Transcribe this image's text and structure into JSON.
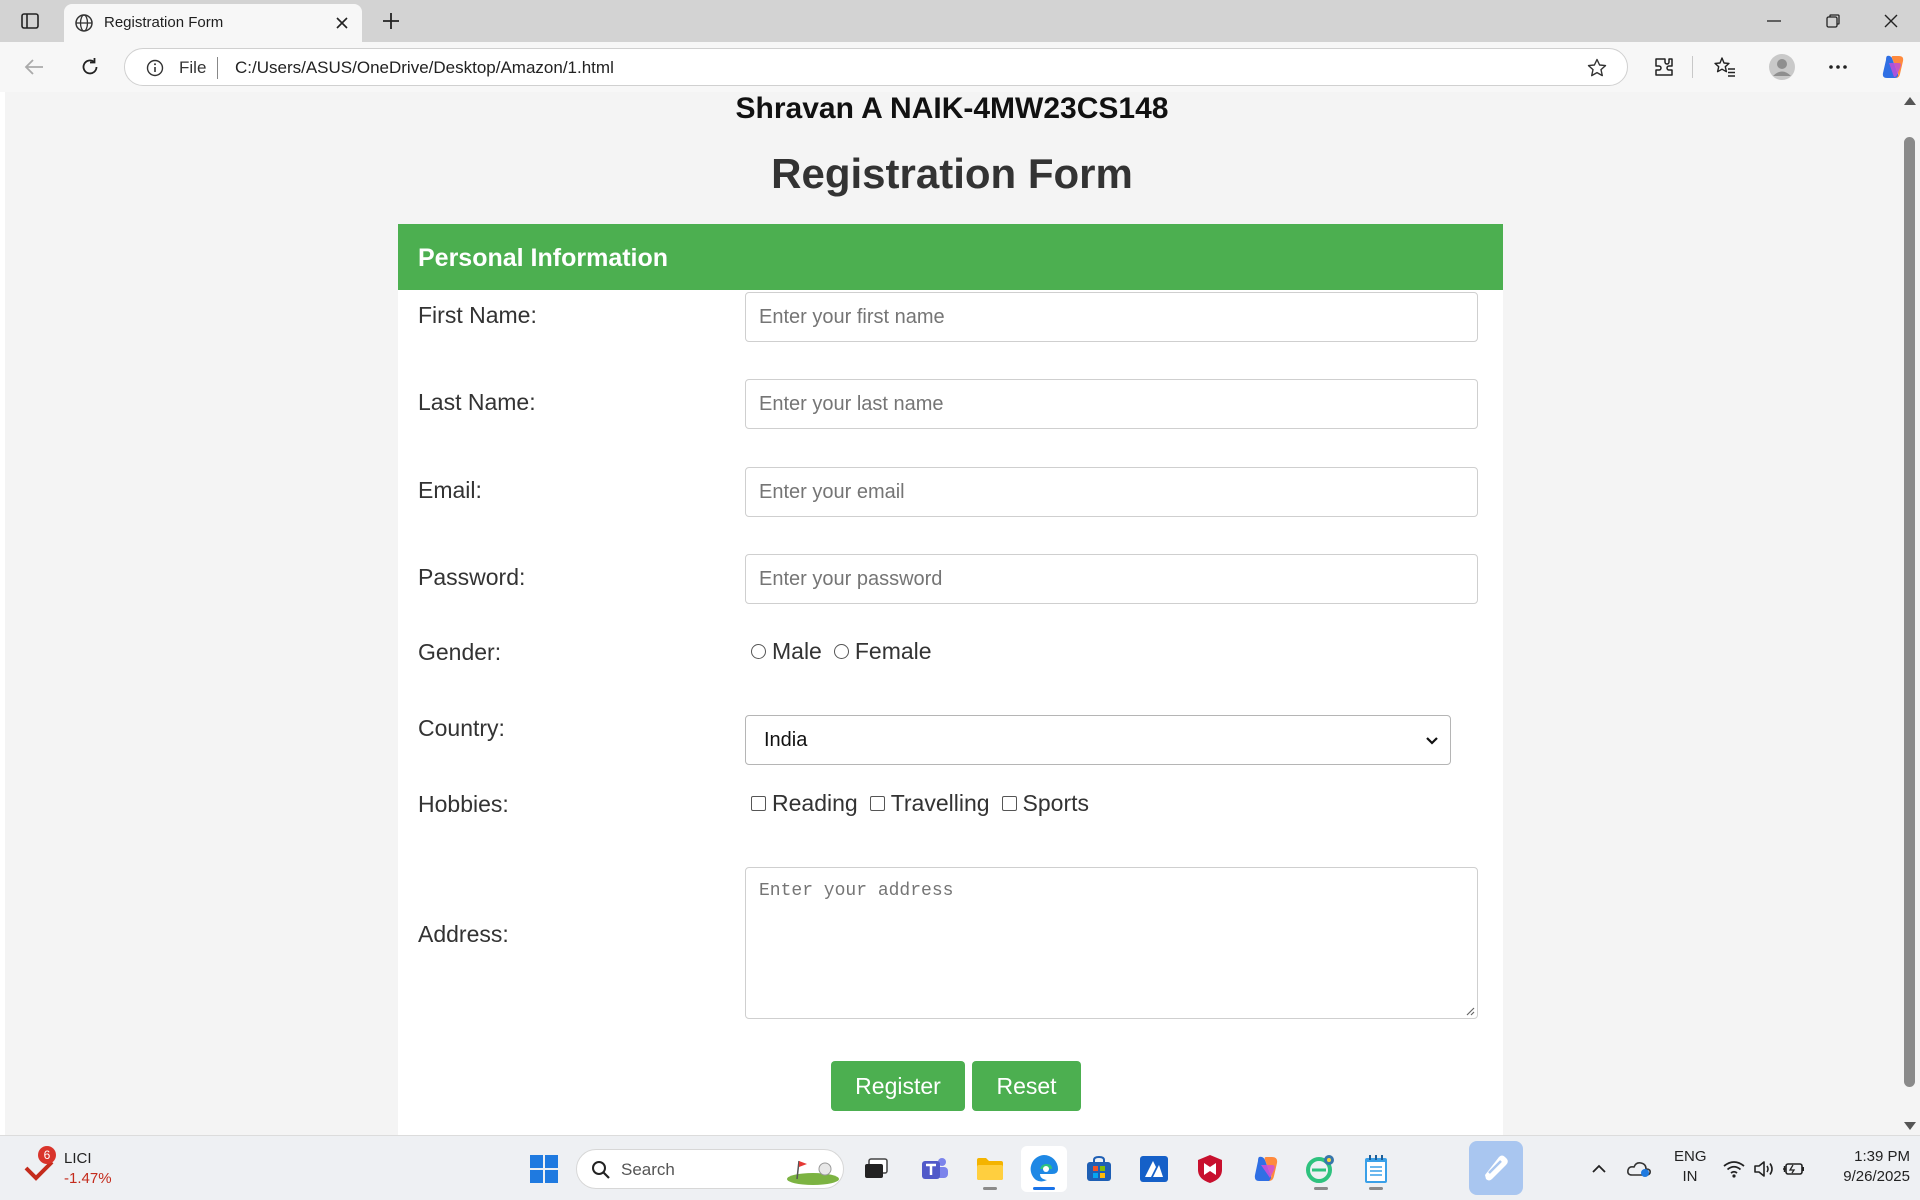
{
  "browser": {
    "tab_title": "Registration Form",
    "address_scheme": "File",
    "address_url": "C:/Users/ASUS/OneDrive/Desktop/Amazon/1.html"
  },
  "page": {
    "student_heading": "Shravan A NAIK-4MW23CS148",
    "title": "Registration Form",
    "section_header": "Personal Information",
    "fields": {
      "first_name": {
        "label": "First Name:",
        "placeholder": "Enter your first name",
        "value": ""
      },
      "last_name": {
        "label": "Last Name:",
        "placeholder": "Enter your last name",
        "value": ""
      },
      "email": {
        "label": "Email:",
        "placeholder": "Enter your email",
        "value": ""
      },
      "password": {
        "label": "Password:",
        "placeholder": "Enter your password",
        "value": ""
      },
      "gender": {
        "label": "Gender:",
        "options": [
          "Male",
          "Female"
        ]
      },
      "country": {
        "label": "Country:",
        "selected": "India"
      },
      "hobbies": {
        "label": "Hobbies:",
        "options": [
          "Reading",
          "Travelling",
          "Sports"
        ]
      },
      "address": {
        "label": "Address:",
        "placeholder": "Enter your address"
      }
    },
    "buttons": {
      "register": "Register",
      "reset": "Reset"
    }
  },
  "taskbar": {
    "stock": {
      "name": "LICI",
      "change": "-1.47%",
      "badge": "6"
    },
    "search_placeholder": "Search",
    "tray": {
      "lang_line1": "ENG",
      "lang_line2": "IN",
      "time": "1:39 PM",
      "date": "9/26/2025"
    }
  },
  "colors": {
    "accent_green": "#4caf50",
    "page_background": "#f4f4f4",
    "card_background": "#ffffff"
  }
}
